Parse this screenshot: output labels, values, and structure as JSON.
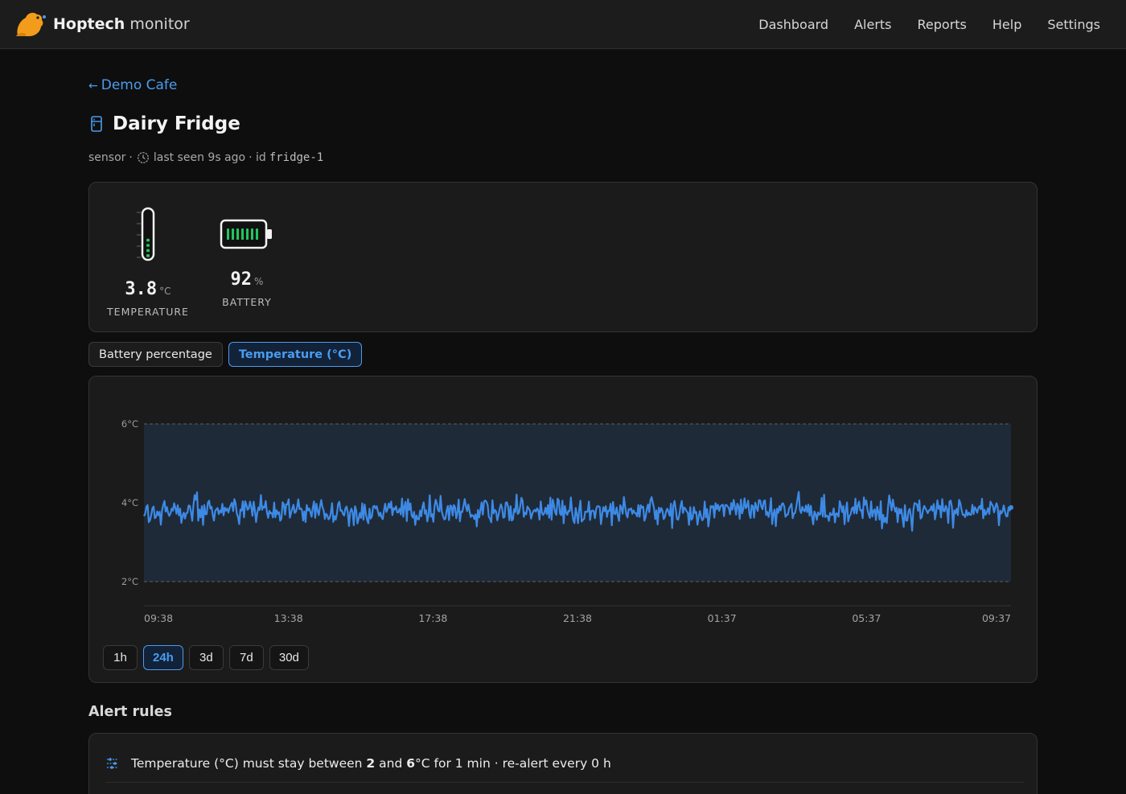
{
  "app": {
    "brand_bold": "Hoptech",
    "brand_light": "monitor",
    "logo_icon": "beaver-logo",
    "accent": "#4a9cf0",
    "logo_color": "#f39c1b"
  },
  "nav": {
    "items": [
      "Dashboard",
      "Alerts",
      "Reports",
      "Help",
      "Settings"
    ]
  },
  "breadcrumb": {
    "arrow": "←",
    "label": "Demo Cafe"
  },
  "device": {
    "icon": "fridge-icon",
    "name": "Dairy Fridge",
    "type": "sensor",
    "separator": "·",
    "last_seen": "last seen 9s ago",
    "id_prefix": "· id",
    "id": "fridge-1"
  },
  "metrics": {
    "temperature": {
      "value": "3.8",
      "unit": "°C",
      "label": "TEMPERATURE",
      "icon": "thermometer-icon",
      "level_fraction": 0.45
    },
    "battery": {
      "value": "92",
      "unit": "%",
      "label": "BATTERY",
      "icon": "battery-icon",
      "level_percent": 92
    }
  },
  "tabs": [
    {
      "label": "Battery percentage",
      "active": false
    },
    {
      "label": "Temperature (°C)",
      "active": true
    }
  ],
  "chart_data": {
    "type": "line",
    "title": "",
    "xlabel": "",
    "ylabel": "",
    "ylim": [
      1.4,
      6.0
    ],
    "y_ticks": [
      {
        "v": 6,
        "label": "6°C"
      },
      {
        "v": 4,
        "label": "4°C"
      },
      {
        "v": 2,
        "label": "2°C"
      }
    ],
    "x_tick_labels": [
      "09:38",
      "13:38",
      "17:38",
      "21:38",
      "01:37",
      "05:37",
      "09:37"
    ],
    "threshold_band": {
      "min": 2,
      "max": 6
    },
    "grid": false,
    "series": [
      {
        "name": "",
        "color": "#3d8ae6",
        "noise_amplitude": 0.34,
        "mean": 3.8,
        "samples": 720,
        "last_value": 3.88
      }
    ]
  },
  "ranges": [
    {
      "label": "1h",
      "active": false
    },
    {
      "label": "24h",
      "active": true
    },
    {
      "label": "3d",
      "active": false
    },
    {
      "label": "7d",
      "active": false
    },
    {
      "label": "30d",
      "active": false
    }
  ],
  "alert_rules": {
    "title": "Alert rules",
    "rules": [
      {
        "icon": "sliders-icon",
        "text_1": "Temperature (°C) must stay between ",
        "min": "2",
        "text_2": " and ",
        "max": "6",
        "text_3": "°C for 1 min · re-alert every 0 h"
      }
    ]
  }
}
